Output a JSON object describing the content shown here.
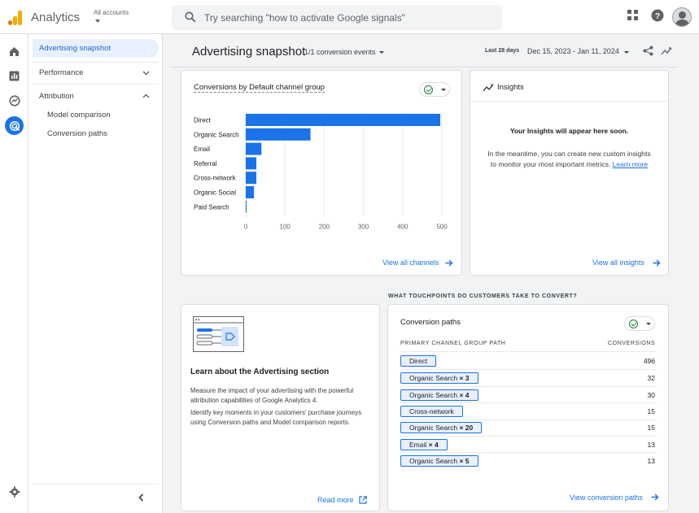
{
  "app": {
    "title": "Analytics",
    "account_label": "All accounts"
  },
  "search": {
    "placeholder": "Try searching \"how to activate Google signals\""
  },
  "subnav": {
    "items": [
      {
        "label": "Advertising snapshot"
      },
      {
        "label": "Performance"
      },
      {
        "label": "Attribution"
      },
      {
        "label": "Model comparison"
      },
      {
        "label": "Conversion paths"
      }
    ]
  },
  "header": {
    "title": "Advertising snapshot",
    "conversion_events": "1/1 conversion events",
    "date_label": "Last 28 days",
    "date_range": "Dec 15, 2023 - Jan 11, 2024"
  },
  "channels_card": {
    "title": "Conversions by Default channel group",
    "link": "View all channels"
  },
  "chart_data": {
    "type": "bar",
    "orientation": "horizontal",
    "categories": [
      "Direct",
      "Organic Search",
      "Email",
      "Referral",
      "Cross-network",
      "Organic Social",
      "Paid Search"
    ],
    "values": [
      496,
      165,
      40,
      27,
      27,
      21,
      2
    ],
    "xlim": [
      0,
      500
    ],
    "xticks": [
      "0",
      "100",
      "200",
      "300",
      "400",
      "500"
    ],
    "color": "#1a73e8"
  },
  "insights_card": {
    "title": "Insights",
    "heading": "Your Insights will appear here soon.",
    "body_line1": "In the meantime, you can create new custom insights",
    "body_line2": "to monitor your most important metrics.",
    "learn_more": "Learn more",
    "link": "View all insights"
  },
  "touchpoints_heading": "WHAT TOUCHPOINTS DO CUSTOMERS TAKE TO CONVERT?",
  "learn_card": {
    "title": "Learn about the Advertising section",
    "p1_line1": "Measure the impact of your advertising with the powerful",
    "p1_line2": "attribution capabilities of Google Analytics 4.",
    "p2_line1": "Identify key moments in your customers' purchase journeys",
    "p2_line2": "using Conversion paths and Model comparison reports.",
    "link": "Read more"
  },
  "paths_card": {
    "title": "Conversion paths",
    "col_path": "PRIMARY CHANNEL GROUP PATH",
    "col_conv": "CONVERSIONS",
    "rows": [
      {
        "name": "Direct",
        "mult": "",
        "value": "496"
      },
      {
        "name": "Organic Search",
        "mult": "× 3",
        "value": "32"
      },
      {
        "name": "Organic Search",
        "mult": "× 4",
        "value": "30"
      },
      {
        "name": "Cross-network",
        "mult": "",
        "value": "15"
      },
      {
        "name": "Organic Search",
        "mult": "× 20",
        "value": "15"
      },
      {
        "name": "Email",
        "mult": "× 4",
        "value": "13"
      },
      {
        "name": "Organic Search",
        "mult": "× 5",
        "value": "13"
      }
    ],
    "link": "View conversion paths"
  },
  "colors": {
    "accent": "#1a73e8",
    "logo_orange": "#f9ab00",
    "logo_dark": "#e37400",
    "check_green": "#188038"
  }
}
